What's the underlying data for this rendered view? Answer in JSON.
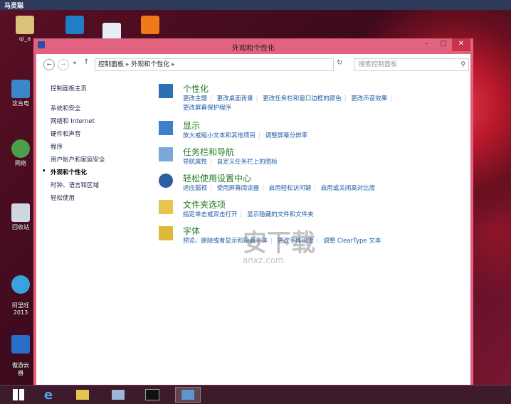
{
  "topbar": {
    "user": "马灵聪"
  },
  "desktop_icons": [
    {
      "label": "qi_a"
    },
    {
      "label": "这台电"
    },
    {
      "label": "网络"
    },
    {
      "label": "回收站"
    },
    {
      "label": "阿里旺\n2013"
    },
    {
      "label": "傲游云\n器"
    }
  ],
  "window": {
    "title": "外观和个性化",
    "breadcrumbs": [
      "控制面板",
      "外观和个性化"
    ],
    "search_placeholder": "搜索控制面板"
  },
  "sidebar": {
    "items": [
      "控制面板主页",
      "系统和安全",
      "网络和 Internet",
      "硬件和声音",
      "程序",
      "用户帐户和家庭安全",
      "外观和个性化",
      "时钟、语言和区域",
      "轻松使用"
    ]
  },
  "sections": [
    {
      "title": "个性化",
      "links": [
        "更改主题",
        "更改桌面背景",
        "更改任务栏和窗口边框的颜色",
        "更改声音效果",
        "更改屏幕保护程序"
      ]
    },
    {
      "title": "显示",
      "links": [
        "放大或缩小文本和其他项目",
        "调整屏幕分辨率"
      ]
    },
    {
      "title": "任务栏和导航",
      "links": [
        "导航属性",
        "自定义任务栏上的图标"
      ]
    },
    {
      "title": "轻松使用设置中心",
      "links": [
        "适应弱视",
        "使用屏幕阅读器",
        "启用轻松访问键",
        "启用或关闭高对比度"
      ]
    },
    {
      "title": "文件夹选项",
      "links": [
        "指定单击或双击打开",
        "显示隐藏的文件和文件夹"
      ]
    },
    {
      "title": "字体",
      "links": [
        "预览、删除或者显示和隐藏字体",
        "更改字体设置",
        "调整 ClearType 文本"
      ]
    }
  ],
  "watermark": {
    "text": "安下载",
    "sub": "anxz.com"
  }
}
